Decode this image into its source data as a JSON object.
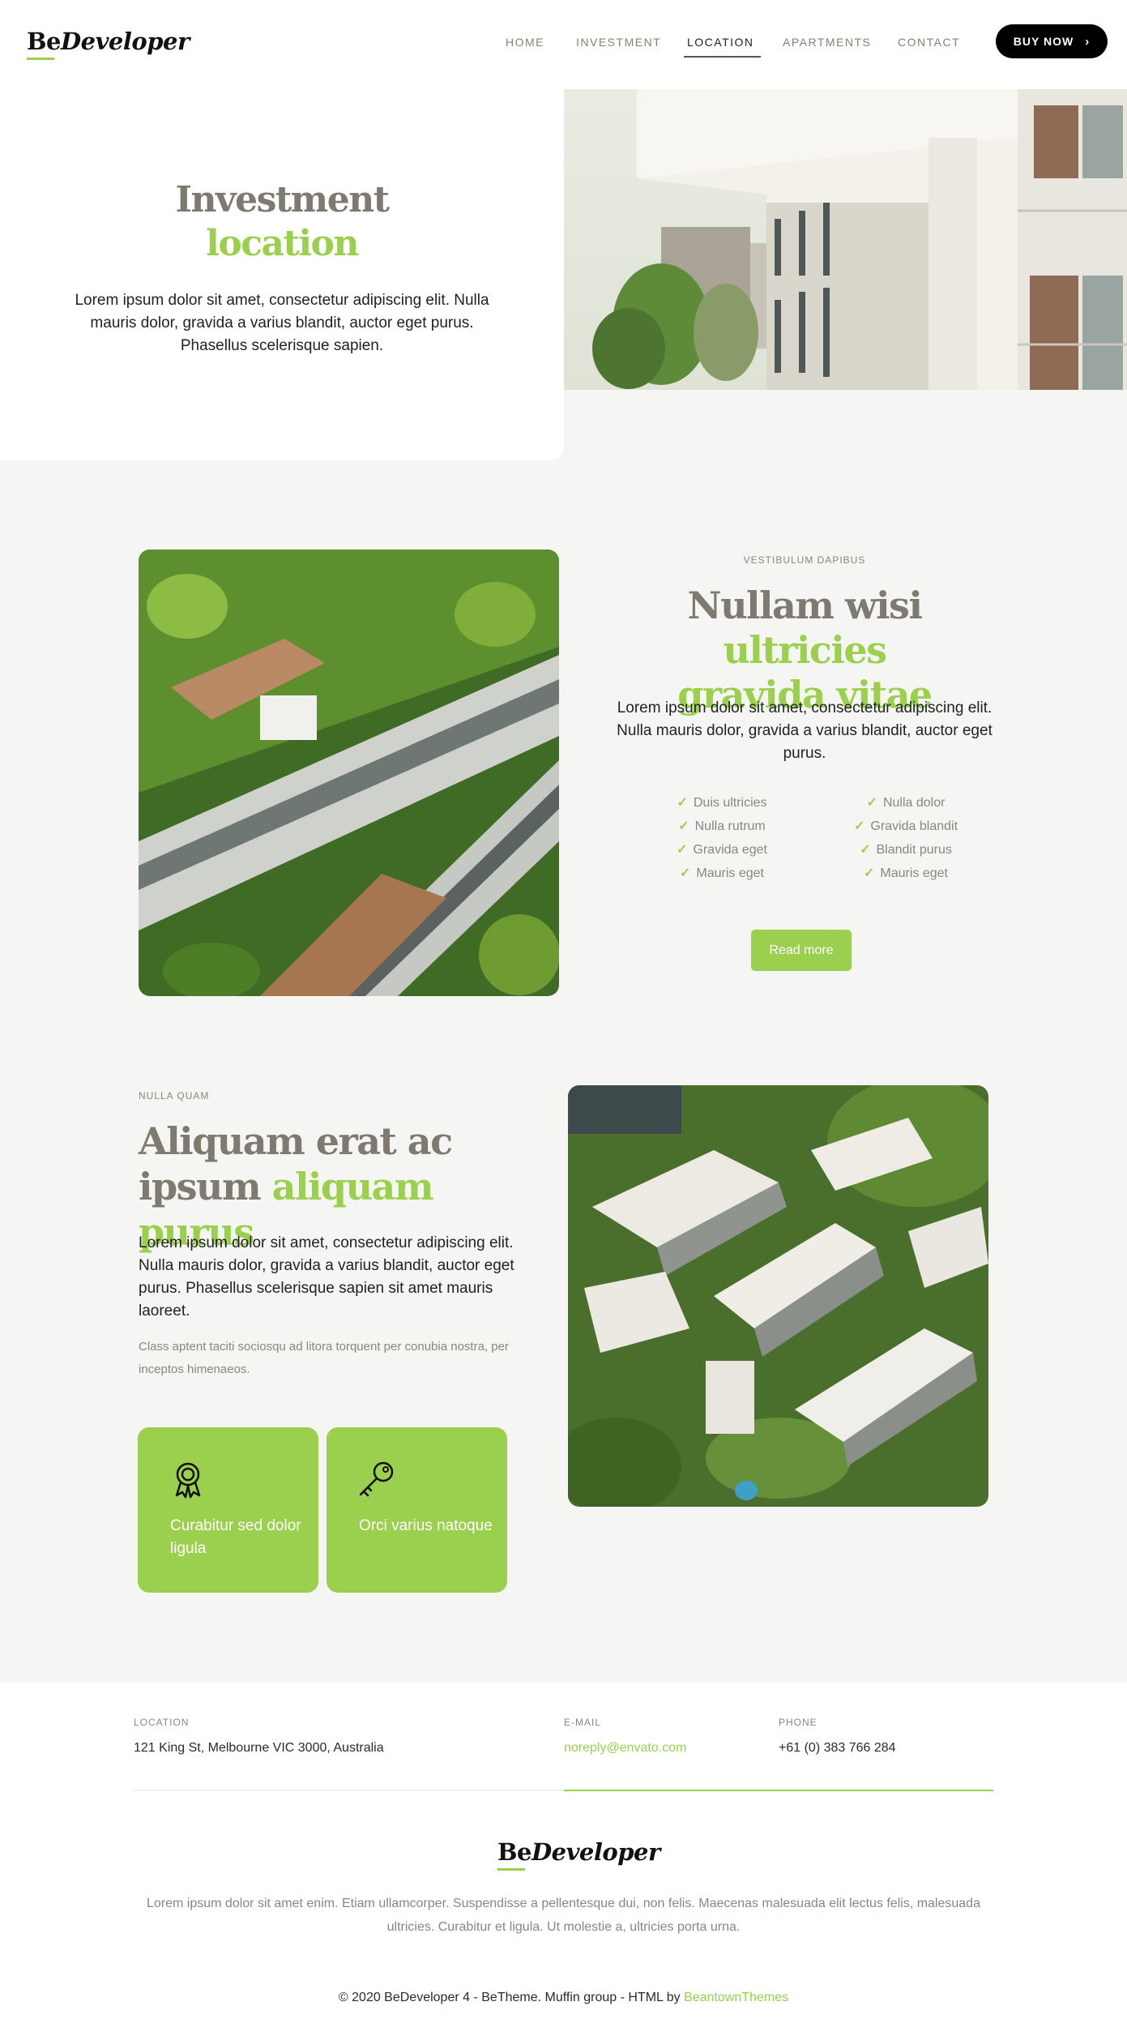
{
  "header": {
    "logo_be": "Be",
    "logo_rest": "Developer",
    "nav": [
      "HOME",
      "INVESTMENT",
      "LOCATION",
      "APARTMENTS",
      "CONTACT"
    ],
    "active_nav": "LOCATION",
    "buy_label": "BUY NOW"
  },
  "hero": {
    "title_line1": "Investment",
    "title_line2": "location",
    "text": "Lorem ipsum dolor sit amet, consectetur adipiscing elit. Nulla mauris dolor, gravida a varius blandit, auctor eget purus. Phasellus scelerisque sapien."
  },
  "section1": {
    "eyebrow": "VESTIBULUM DAPIBUS",
    "title_grey": "Nullam wisi",
    "title_green_1": "ultricies",
    "title_green_2": "gravida vitae",
    "text": "Lorem ipsum dolor sit amet, consectetur adipiscing elit. Nulla mauris dolor, gravida a varius blandit, auctor eget purus.",
    "list_left": [
      "Duis ultricies",
      "Nulla rutrum",
      "Gravida eget",
      "Mauris eget"
    ],
    "list_right": [
      "Nulla dolor",
      "Gravida blandit",
      "Blandit purus",
      "Mauris eget"
    ],
    "button": "Read more"
  },
  "section2": {
    "eyebrow": "NULLA QUAM",
    "title_grey_1": "Aliquam erat ac",
    "title_grey_2": "ipsum",
    "title_green": "aliquam purus",
    "text": "Lorem ipsum dolor sit amet, consectetur adipiscing elit. Nulla mauris dolor, gravida a varius blandit, auctor eget purus. Phasellus scelerisque sapien sit amet mauris laoreet.",
    "subtext": "Class aptent taciti sociosqu ad litora torquent per conubia nostra, per inceptos himenaeos.",
    "features": [
      {
        "icon": "award-ribbon-icon",
        "text": "Curabitur sed dolor ligula"
      },
      {
        "icon": "key-icon",
        "text": "Orci varius natoque"
      }
    ]
  },
  "footer": {
    "location_label": "LOCATION",
    "location_value": "121 King St, Melbourne VIC 3000, Australia",
    "email_label": "E-MAIL",
    "email_value": "noreply@envato.com",
    "phone_label": "PHONE",
    "phone_value": "+61 (0) 383 766 284",
    "logo_be": "Be",
    "logo_rest": "Developer",
    "description": "Lorem ipsum dolor sit amet enim. Etiam ullamcorper. Suspendisse a pellentesque dui, non felis. Maecenas malesuada elit lectus felis, malesuada ultricies. Curabitur et ligula. Ut molestie a, ultricies porta urna.",
    "copyright": "© 2020 BeDeveloper 4 - BeTheme. Muffin group - HTML by",
    "copyright_link": "BeantownThemes"
  },
  "colors": {
    "accent": "#9bd04f",
    "heading_grey": "#7f7a70",
    "background": "#f5f5f3"
  }
}
